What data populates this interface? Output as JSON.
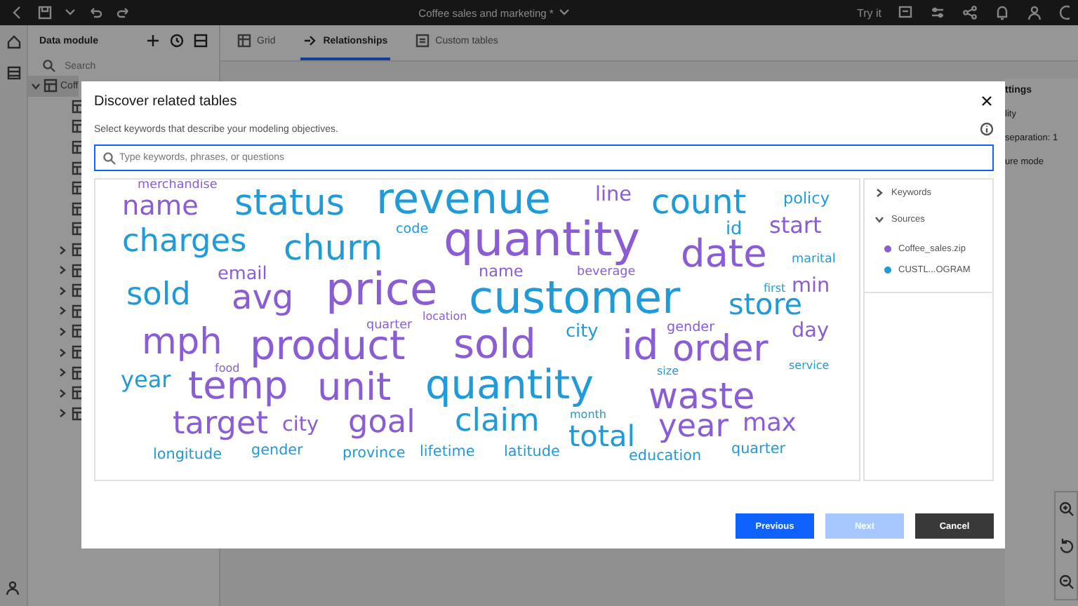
{
  "top_bar": {
    "title": "Coffee sales and marketing *",
    "try_it": "Try it"
  },
  "sidebar": {
    "title": "Data module",
    "search_placeholder": "Search",
    "tree": [
      {
        "label": "Coff",
        "expanded": true,
        "selected": true,
        "children": [
          {
            "kind": "table"
          },
          {
            "kind": "table"
          },
          {
            "kind": "table"
          },
          {
            "kind": "table"
          },
          {
            "kind": "table"
          },
          {
            "kind": "table"
          },
          {
            "kind": "table"
          },
          {
            "kind": "folder",
            "expanded": false
          },
          {
            "kind": "folder",
            "expanded": false
          },
          {
            "kind": "folder",
            "expanded": false
          },
          {
            "kind": "folder",
            "expanded": false
          },
          {
            "kind": "folder",
            "expanded": false
          },
          {
            "kind": "folder",
            "expanded": false
          },
          {
            "kind": "folder",
            "expanded": false
          },
          {
            "kind": "folder",
            "expanded": false
          },
          {
            "kind": "folder",
            "expanded": false
          }
        ]
      }
    ]
  },
  "tabs": [
    {
      "label": "Grid",
      "selected": false
    },
    {
      "label": "Relationships",
      "selected": true
    },
    {
      "label": "Custom tables",
      "selected": false
    }
  ],
  "properties_panel": {
    "title": "ttings",
    "lines": [
      "lity",
      "separation: 1",
      "ure mode"
    ]
  },
  "dialog": {
    "title": "Discover related tables",
    "subtitle": "Select keywords that describe your modeling objectives.",
    "search": {
      "placeholder": "Type keywords, phrases, or questions"
    },
    "words": [
      {
        "text": "merchandise",
        "color": "#8a5cd6"
      },
      {
        "text": "revenue",
        "color": "#1f9bd9"
      },
      {
        "text": "line",
        "color": "#8a5cd6"
      },
      {
        "text": "count",
        "color": "#1f9bd9"
      },
      {
        "text": "policy",
        "color": "#1f9bd9"
      },
      {
        "text": "name",
        "color": "#8a5cd6"
      },
      {
        "text": "status",
        "color": "#1f9bd9"
      },
      {
        "text": "code",
        "color": "#1f9bd9"
      },
      {
        "text": "quantity",
        "color": "#8a5cd6"
      },
      {
        "text": "id",
        "color": "#1f9bd9"
      },
      {
        "text": "start",
        "color": "#8a5cd6"
      },
      {
        "text": "charges",
        "color": "#1f9bd9"
      },
      {
        "text": "churn",
        "color": "#1f9bd9"
      },
      {
        "text": "date",
        "color": "#8a5cd6"
      },
      {
        "text": "email",
        "color": "#8a5cd6"
      },
      {
        "text": "name",
        "color": "#8a5cd6"
      },
      {
        "text": "beverage",
        "color": "#8a5cd6"
      },
      {
        "text": "marital",
        "color": "#1f9bd9"
      },
      {
        "text": "sold",
        "color": "#1f9bd9"
      },
      {
        "text": "avg",
        "color": "#8a5cd6"
      },
      {
        "text": "price",
        "color": "#8a5cd6"
      },
      {
        "text": "customer",
        "color": "#1f9bd9"
      },
      {
        "text": "first",
        "color": "#1f9bd9"
      },
      {
        "text": "min",
        "color": "#8a5cd6"
      },
      {
        "text": "store",
        "color": "#1f9bd9"
      },
      {
        "text": "quarter",
        "color": "#8a5cd6"
      },
      {
        "text": "location",
        "color": "#8a5cd6"
      },
      {
        "text": "gender",
        "color": "#8a5cd6"
      },
      {
        "text": "mph",
        "color": "#8a5cd6"
      },
      {
        "text": "product",
        "color": "#8a5cd6"
      },
      {
        "text": "sold",
        "color": "#8a5cd6"
      },
      {
        "text": "city",
        "color": "#1f9bd9"
      },
      {
        "text": "id",
        "color": "#8a5cd6"
      },
      {
        "text": "order",
        "color": "#8a5cd6"
      },
      {
        "text": "day",
        "color": "#8a5cd6"
      },
      {
        "text": "food",
        "color": "#8a5cd6"
      },
      {
        "text": "service",
        "color": "#1f9bd9"
      },
      {
        "text": "year",
        "color": "#1f9bd9"
      },
      {
        "text": "temp",
        "color": "#8a5cd6"
      },
      {
        "text": "unit",
        "color": "#8a5cd6"
      },
      {
        "text": "quantity",
        "color": "#1f9bd9"
      },
      {
        "text": "size",
        "color": "#1f9bd9"
      },
      {
        "text": "waste",
        "color": "#8a5cd6"
      },
      {
        "text": "target",
        "color": "#8a5cd6"
      },
      {
        "text": "city",
        "color": "#8a5cd6"
      },
      {
        "text": "goal",
        "color": "#8a5cd6"
      },
      {
        "text": "claim",
        "color": "#1f9bd9"
      },
      {
        "text": "month",
        "color": "#1f9bd9"
      },
      {
        "text": "total",
        "color": "#1f9bd9"
      },
      {
        "text": "year",
        "color": "#8a5cd6"
      },
      {
        "text": "max",
        "color": "#8a5cd6"
      },
      {
        "text": "longitude",
        "color": "#1f9bd9"
      },
      {
        "text": "gender",
        "color": "#1f9bd9"
      },
      {
        "text": "province",
        "color": "#1f9bd9"
      },
      {
        "text": "lifetime",
        "color": "#1f9bd9"
      },
      {
        "text": "latitude",
        "color": "#1f9bd9"
      },
      {
        "text": "education",
        "color": "#1f9bd9"
      },
      {
        "text": "quarter",
        "color": "#1f9bd9"
      }
    ],
    "panel_sections": [
      {
        "label": "Keywords",
        "expanded": false
      },
      {
        "label": "Sources",
        "expanded": true,
        "items": [
          {
            "label": "Coffee_sales.zip",
            "color": "#8a5cd6"
          },
          {
            "label": "CUSTL...OGRAM",
            "color": "#1f9bd9"
          }
        ]
      }
    ],
    "buttons": [
      {
        "label": "Previous",
        "kind": "primary",
        "disabled": false
      },
      {
        "label": "Next",
        "kind": "primary",
        "disabled": true
      },
      {
        "label": "Cancel",
        "kind": "secondary",
        "disabled": false
      }
    ]
  }
}
